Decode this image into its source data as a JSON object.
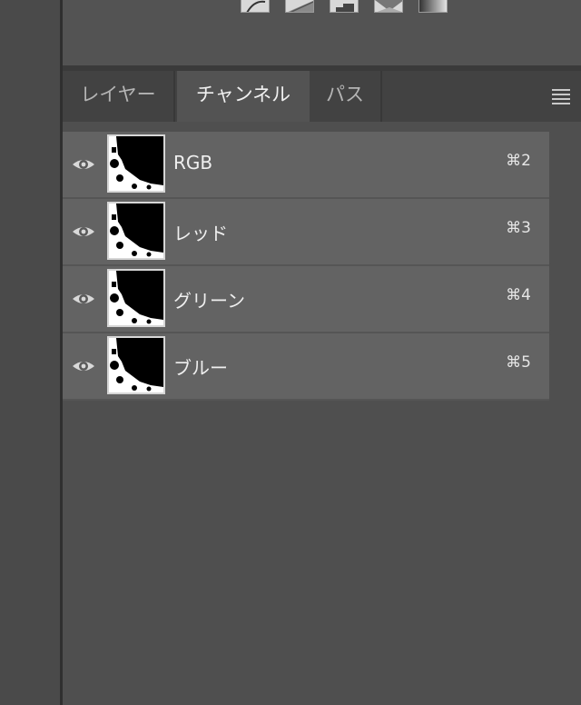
{
  "tabs": [
    {
      "label": "レイヤー"
    },
    {
      "label": "チャンネル"
    },
    {
      "label": "パス"
    }
  ],
  "active_tab": "チャンネル",
  "channels": [
    {
      "name": "RGB",
      "shortcut": "⌘2"
    },
    {
      "name": "レッド",
      "shortcut": "⌘3"
    },
    {
      "name": "グリーン",
      "shortcut": "⌘4"
    },
    {
      "name": "ブルー",
      "shortcut": "⌘5"
    }
  ],
  "icons": {
    "visibility": "eye-icon",
    "panel_menu": "hamburger-menu-icon",
    "adjustments": [
      "curves-icon",
      "exposure-icon",
      "posterize-icon",
      "threshold-icon",
      "gradient-map-icon"
    ]
  },
  "colors": {
    "panel_bg": "#4f4f4f",
    "row_bg": "#636363",
    "tab_active_bg": "#535353",
    "tab_bar_bg": "#424242"
  }
}
